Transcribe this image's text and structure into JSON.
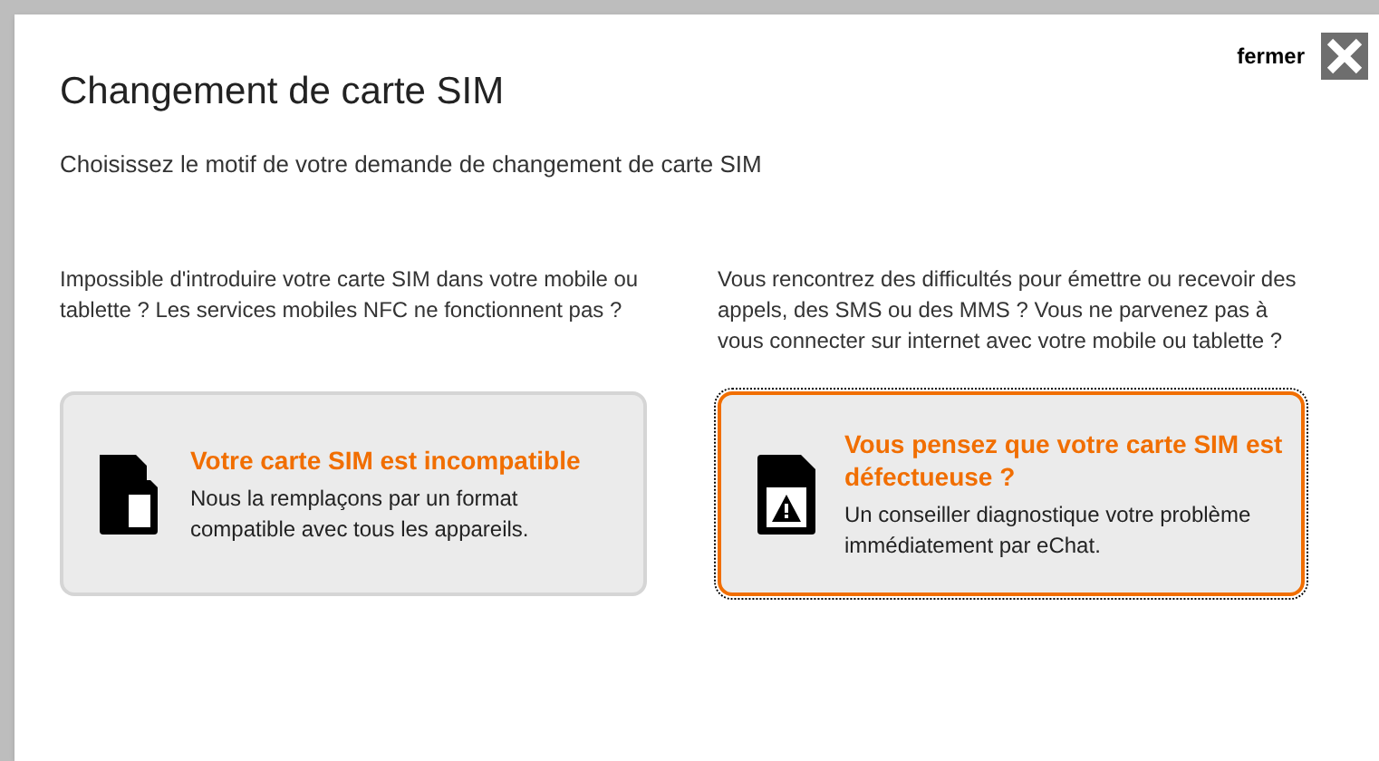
{
  "dialog": {
    "title": "Changement de carte SIM",
    "close_label": "fermer",
    "subtitle": "Choisissez le motif de votre demande de changement de carte SIM"
  },
  "options": [
    {
      "kind": "incompatible",
      "description": "Impossible d'introduire votre carte SIM dans votre mobile ou tablette ? Les services mobiles NFC ne fonctionnent pas ?",
      "heading": "Votre carte SIM est incompatible",
      "detail": "Nous la remplaçons par un format compatible avec tous les appareils.",
      "selected": false
    },
    {
      "kind": "defective",
      "description": "Vous rencontrez des difficultés pour émettre ou recevoir des appels, des SMS ou des MMS ? Vous ne parvenez pas à vous connecter sur internet avec votre mobile ou tablette ?",
      "heading": "Vous pensez que votre carte SIM est défectueuse ?",
      "detail": "Un conseiller diagnostique votre problème immédiatement par eChat.",
      "selected": true
    }
  ]
}
